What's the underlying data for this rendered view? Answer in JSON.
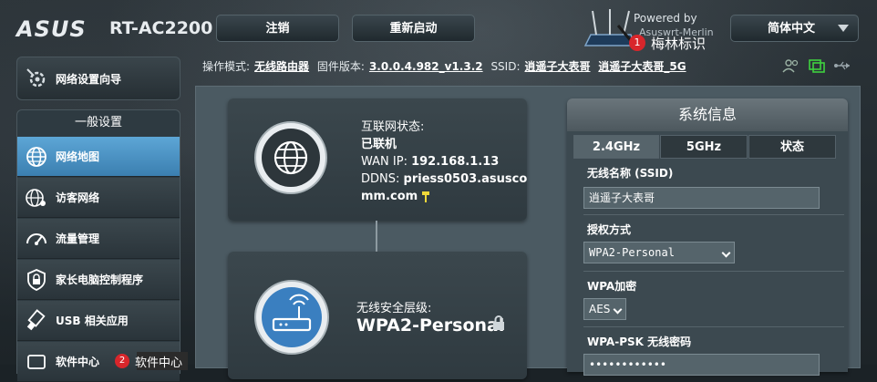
{
  "header": {
    "brand": "ASUS",
    "model": "RT-AC2200",
    "logout_label": "注销",
    "reboot_label": "重新启动",
    "powered_by": "Powered by",
    "firmware_vendor": "Asuswrt-Merlin",
    "language": "简体中文"
  },
  "watermarks": [
    {
      "num": "1",
      "text": "梅林标识"
    },
    {
      "num": "2",
      "text": "软件中心"
    }
  ],
  "statusbar": {
    "mode_label": "操作模式:",
    "mode_value": "无线路由器",
    "fw_label": "固件版本:",
    "fw_value": "3.0.0.4.982_v1.3.2",
    "ssid_label": "SSID:",
    "ssid_2g": "逍遥子大表哥",
    "ssid_5g": "逍遥子大表哥_5G"
  },
  "sidebar": {
    "quick_setup": "网络设置向导",
    "group_title": "一般设置",
    "items": [
      {
        "label": "网络地图",
        "icon": "globe-icon",
        "active": true
      },
      {
        "label": "访客网络",
        "icon": "guest-network-icon"
      },
      {
        "label": "流量管理",
        "icon": "gauge-icon"
      },
      {
        "label": "家长电脑控制程序",
        "icon": "parental-shield-icon"
      },
      {
        "label": "USB 相关应用",
        "icon": "usb-icon"
      },
      {
        "label": "软件中心",
        "icon": "software-center-icon"
      }
    ]
  },
  "internet_card": {
    "status_label": "互联网状态:",
    "status_value": "已联机",
    "wan_ip_label": "WAN IP:",
    "wan_ip": "192.168.1.13",
    "ddns_label": "DDNS:",
    "ddns_line1": "priess0503.asusco",
    "ddns_line2": "mm.com"
  },
  "security_card": {
    "label": "无线安全层级:",
    "value": "WPA2-Personal"
  },
  "system_info": {
    "title": "系统信息",
    "tabs": [
      "2.4GHz",
      "5GHz",
      "状态"
    ],
    "ssid_label": "无线名称 (SSID)",
    "ssid_value": "逍遥子大表哥",
    "auth_label": "授权方式",
    "auth_value": "WPA2-Personal",
    "wpa_label": "WPA加密",
    "wpa_value": "AES",
    "psk_label": "WPA-PSK 无线密码",
    "psk_value": "••••••••••••"
  },
  "colors": {
    "accent_active": "#4e93c4",
    "badge_red": "#d8262b",
    "hint_yellow": "#f0d83a"
  }
}
